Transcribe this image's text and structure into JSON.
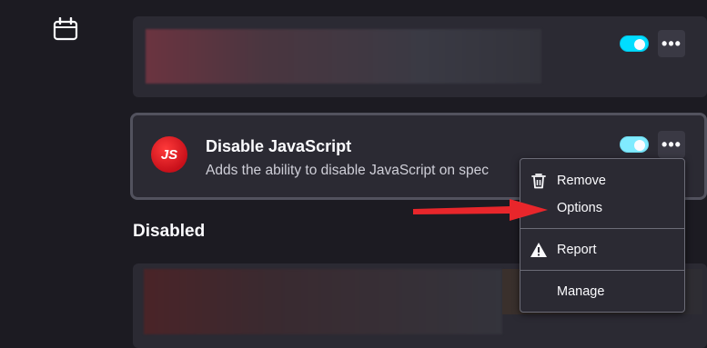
{
  "sidebar": {
    "icon": "calendar-icon"
  },
  "cards": {
    "enabled_first": {
      "toggle_on": true,
      "more_label": "•••"
    },
    "enabled_js": {
      "logo_text": "JS",
      "name": "Disable JavaScript",
      "description": "Adds the ability to disable JavaScript on spec",
      "toggle_on": true,
      "more_label": "•••"
    }
  },
  "sections": {
    "disabled_title": "Disabled"
  },
  "context_menu": {
    "items": [
      {
        "label": "Remove",
        "icon": "trash-icon"
      },
      {
        "label": "Options",
        "icon": ""
      },
      {
        "label": "Report",
        "icon": "warning-icon"
      },
      {
        "label": "Manage",
        "icon": ""
      }
    ]
  },
  "colors": {
    "accent": "#00ddff",
    "background": "#1c1b22",
    "card": "#2b2a33",
    "arrow": "#e8262b",
    "js_logo": "#d8141f"
  }
}
